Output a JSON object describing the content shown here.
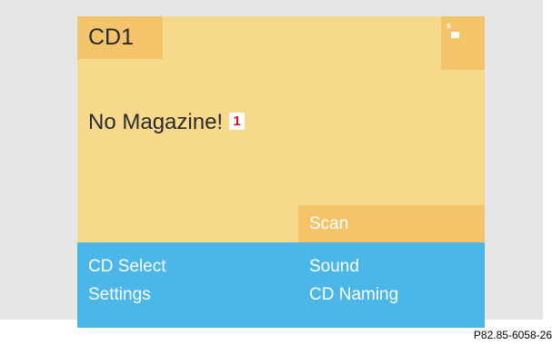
{
  "display": {
    "source_tab": "CD1",
    "status_icon": {
      "name": "signal-icon",
      "letter": "s"
    },
    "message": "No Magazine!",
    "callout_number": "1",
    "scan_label": "Scan"
  },
  "menu": {
    "cd_select": "CD Select",
    "sound": "Sound",
    "settings": "Settings",
    "cd_naming": "CD Naming"
  },
  "figure": {
    "reference_code": "P82.85-6058-26"
  },
  "colors": {
    "screen_background": "#f7d98c",
    "tab_highlight": "#f4c46a",
    "menu_background": "#4bb6e8",
    "callout_red": "#c0142a",
    "frame_background": "#e6e6e6"
  }
}
